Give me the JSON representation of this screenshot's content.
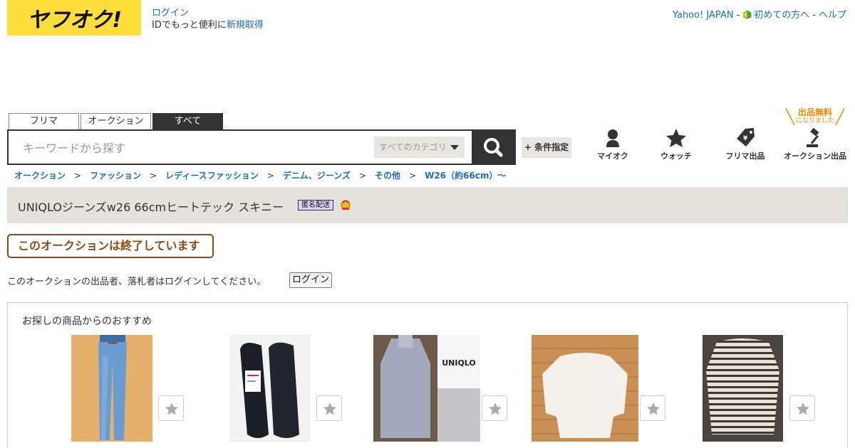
{
  "logo": {
    "text": "ヤフオク!"
  },
  "login": {
    "link": "ログイン",
    "sub_prefix": "IDでもっと便利に",
    "signup": "新規取得"
  },
  "top_links": {
    "yahoo": "Yahoo! JAPAN",
    "sep": "-",
    "beginner": "初めての方へ",
    "help": "ヘルプ"
  },
  "tabs": [
    {
      "label": "フリマ"
    },
    {
      "label": "オークション"
    },
    {
      "label": "すべて"
    }
  ],
  "search": {
    "placeholder": "キーワードから探す",
    "category": "すべてのカテゴリ",
    "conditions": "+ 条件指定"
  },
  "nav": {
    "myauc": "マイオク",
    "watch": "ウォッチ",
    "flea_sell": "フリマ出品",
    "auction_sell": "オークション出品",
    "free_badge_big": "出品無料",
    "free_badge_small": "になりました"
  },
  "breadcrumb": [
    "オークション",
    "ファッション",
    "レディースファッション",
    "デニム、ジーンズ",
    "その他",
    "W26（約66cm）～"
  ],
  "breadcrumb_sep": ">",
  "item": {
    "title": "UNIQLOジーンズw26 66cmヒートテック スキニー",
    "anon_badge": "匿名配送"
  },
  "ended": {
    "message": "このオークションは終了しています"
  },
  "notice": {
    "text": "このオークションの出品者、落札者はログインしてください。",
    "login_button": "ログイン"
  },
  "recommend": {
    "title": "お探しの商品からのおすすめ",
    "items": [
      {
        "image": "jeans"
      },
      {
        "image": "black-flats"
      },
      {
        "image": "gray-knit"
      },
      {
        "image": "white-sweater"
      },
      {
        "image": "striped-top"
      }
    ],
    "uniqlo_label": "UNIQLO"
  },
  "colors": {
    "brand_yellow": "#ffdf3b",
    "link": "#1b6fbd",
    "ended_brown": "#8b4a17",
    "free_orange": "#f08a00"
  }
}
